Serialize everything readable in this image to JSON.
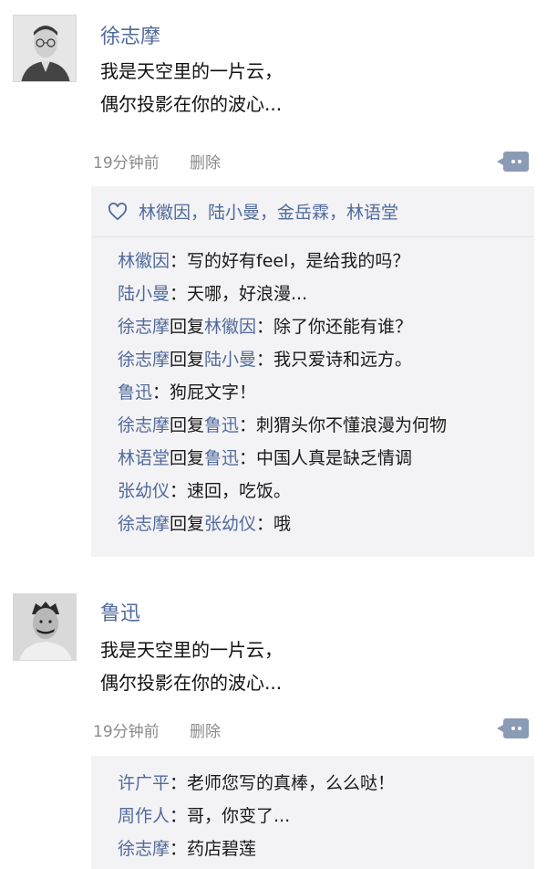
{
  "posts": [
    {
      "author": "徐志摩",
      "content_lines": [
        "我是天空里的一片云，",
        "偶尔投影在你的波心..."
      ],
      "time": "19分钟前",
      "delete_label": "删除",
      "likes": "林徽因，陆小曼，金岳霖，林语堂",
      "comments": [
        {
          "name": "林徽因",
          "text": "：写的好有feel，是给我的吗？"
        },
        {
          "name": "陆小曼",
          "text": "：天哪，好浪漫..."
        },
        {
          "name": "徐志摩",
          "reply_word": "回复",
          "to": "林徽因",
          "text": "：除了你还能有谁？"
        },
        {
          "name": "徐志摩",
          "reply_word": "回复",
          "to": "陆小曼",
          "text": "：我只爱诗和远方。"
        },
        {
          "name": "鲁迅",
          "text": "：狗屁文字！"
        },
        {
          "name": "徐志摩",
          "reply_word": "回复",
          "to": "鲁迅",
          "text": "：刺猬头你不懂浪漫为何物"
        },
        {
          "name": "林语堂",
          "reply_word": "回复",
          "to": "鲁迅",
          "text": "：中国人真是缺乏情调"
        },
        {
          "name": "张幼仪",
          "text": "：速回，吃饭。"
        },
        {
          "name": "徐志摩",
          "reply_word": "回复",
          "to": "张幼仪",
          "text": "：哦"
        }
      ]
    },
    {
      "author": "鲁迅",
      "content_lines": [
        "我是天空里的一片云，",
        "偶尔投影在你的波心..."
      ],
      "time": "19分钟前",
      "delete_label": "删除",
      "comments": [
        {
          "name": "许广平",
          "text": "：老师您写的真棒，么么哒！"
        },
        {
          "name": "周作人",
          "text": "：哥，你变了..."
        },
        {
          "name": "徐志摩",
          "text": "：药店碧莲"
        }
      ]
    }
  ],
  "colors": {
    "name_link": "#506a9b",
    "meta_gray": "#8a8a8a",
    "reply_bg": "#f3f3f5",
    "comment_button": "#8b9bb6"
  },
  "icons": {
    "like": "heart-icon",
    "comment": "comment-bubble-icon"
  }
}
